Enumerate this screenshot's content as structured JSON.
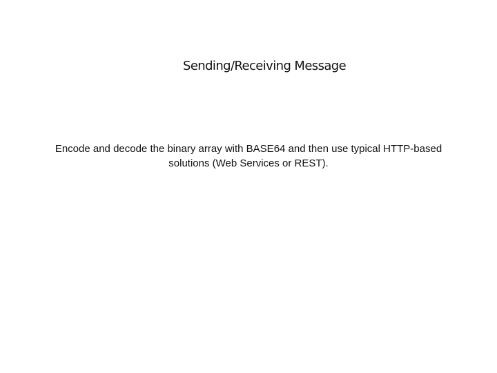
{
  "slide": {
    "title": "Sending/Receiving Message",
    "body_lines": [
      "Encode and decode the binary array with BASE64 and then use typical HTTP-based",
      "solutions (Web Services or REST)."
    ]
  }
}
